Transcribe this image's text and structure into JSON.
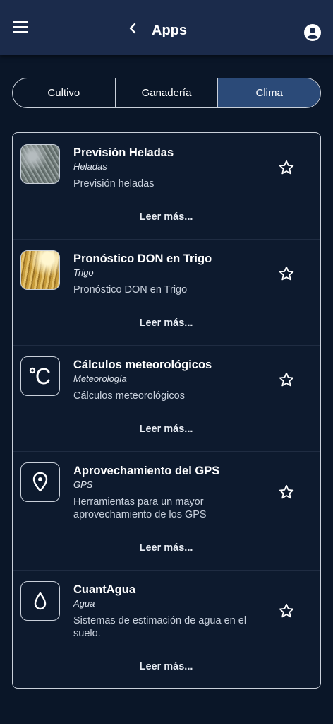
{
  "header": {
    "title": "Apps",
    "menu_icon": "hamburger-menu-icon",
    "back_icon": "chevron-left-icon",
    "account_icon": "account-circle-icon"
  },
  "tabs": [
    {
      "label": "Cultivo",
      "active": false
    },
    {
      "label": "Ganadería",
      "active": false
    },
    {
      "label": "Clima",
      "active": true
    }
  ],
  "colors": {
    "background": "#0a1628",
    "topbar": "#1b2b4b",
    "active_tab": "#2b4a78",
    "border": "#c9d0da"
  },
  "apps": [
    {
      "title": "Previsión Heladas",
      "category": "Heladas",
      "description": "Previsión heladas",
      "more": "Leer más...",
      "icon": "frost-photo",
      "favorite": false
    },
    {
      "title": "Pronóstico DON en Trigo",
      "category": "Trigo",
      "description": "Pronóstico DON en Trigo",
      "more": "Leer más...",
      "icon": "wheat-photo",
      "favorite": false
    },
    {
      "title": "Cálculos meteorológicos",
      "category": "Meteorología",
      "description": "Cálculos meteorológicos",
      "more": "Leer más...",
      "icon": "celsius-icon",
      "favorite": false
    },
    {
      "title": "Aprovechamiento del GPS",
      "category": "GPS",
      "description": "Herramientas para un mayor aprovechamiento de los GPS",
      "more": "Leer más...",
      "icon": "location-pin-icon",
      "favorite": false
    },
    {
      "title": "CuantAgua",
      "category": "Agua",
      "description": "Sistemas de estimación de agua en el suelo.",
      "more": "Leer más...",
      "icon": "water-drop-icon",
      "favorite": false
    }
  ]
}
